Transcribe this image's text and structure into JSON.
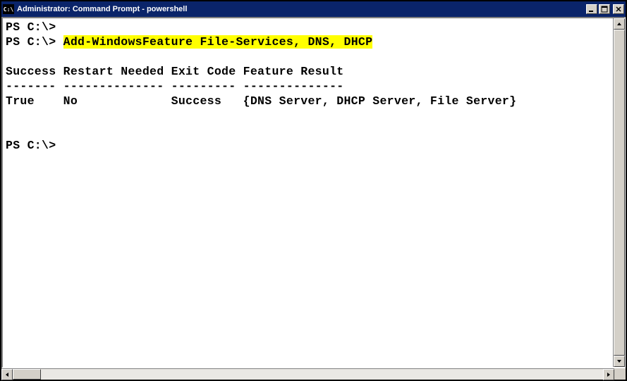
{
  "window": {
    "title": "Administrator: Command Prompt - powershell",
    "icon_label": "C:\\"
  },
  "terminal": {
    "lines": [
      {
        "prompt": "PS C:\\> ",
        "cmd": ""
      },
      {
        "prompt": "PS C:\\> ",
        "cmd": "Add-WindowsFeature File-Services, DNS, DHCP",
        "highlighted": true
      },
      {
        "text": ""
      },
      {
        "text": "Success Restart Needed Exit Code Feature Result"
      },
      {
        "text": "------- -------------- --------- --------------"
      },
      {
        "text": "True    No             Success   {DNS Server, DHCP Server, File Server}"
      },
      {
        "text": ""
      },
      {
        "text": ""
      },
      {
        "prompt": "PS C:\\> ",
        "cmd": ""
      }
    ]
  },
  "controls": {
    "minimize": "_",
    "maximize": "☐",
    "close": "✕"
  }
}
